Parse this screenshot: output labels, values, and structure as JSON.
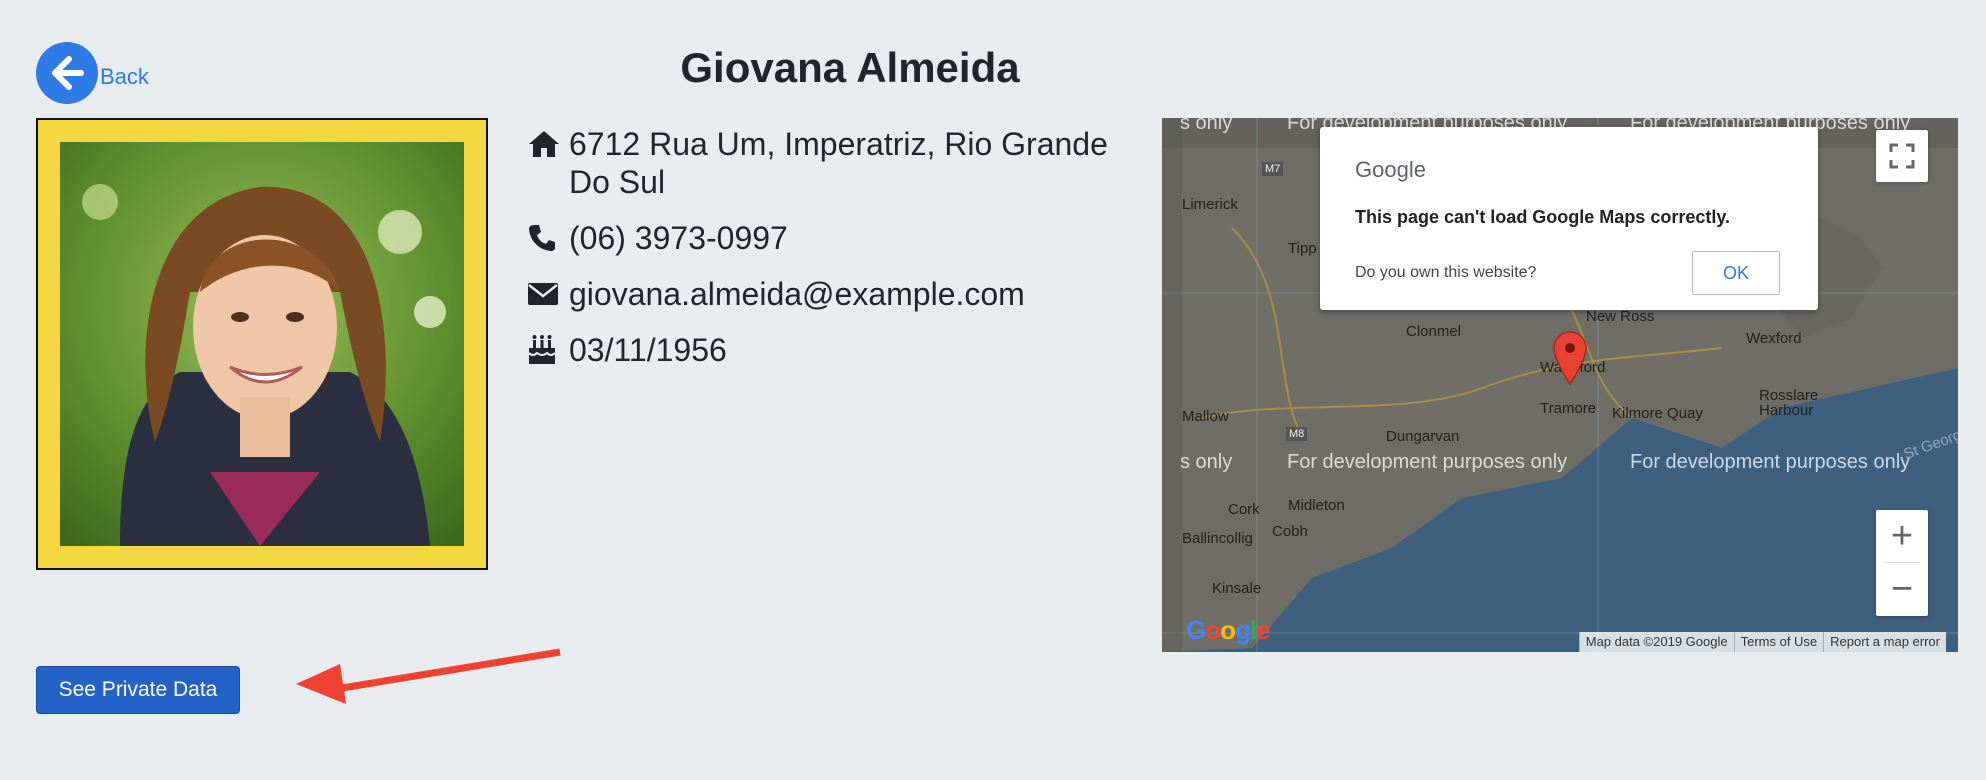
{
  "nav": {
    "back_label": "Back"
  },
  "profile": {
    "name": "Giovana Almeida",
    "address": "6712 Rua Um, Imperatriz, Rio Grande Do Sul",
    "phone": "(06) 3973-0997",
    "email": "giovana.almeida@example.com",
    "birthday": "03/11/1956"
  },
  "map": {
    "dialog": {
      "logo": "Google",
      "message": "This page can't load Google Maps correctly.",
      "question": "Do you own this website?",
      "ok_label": "OK"
    },
    "watermark": "For development purposes only",
    "watermark_partial": "s only",
    "places": [
      "Limerick",
      "Tipp",
      "Clonmel",
      "New Ross",
      "Wexford",
      "Waterford",
      "Tramore",
      "Kilmore Quay",
      "Rosslare Harbour",
      "Mallow",
      "Dungarvan",
      "Midleton",
      "Cork",
      "Ballincollig",
      "Cobh",
      "Kinsale",
      "St George's"
    ],
    "road_labels": [
      "M7",
      "M8"
    ],
    "attribution": [
      "Map data ©2019 Google",
      "Terms of Use",
      "Report a map error"
    ],
    "google_logo": "Google",
    "zoom_in": "+",
    "zoom_out": "−"
  },
  "actions": {
    "private_data_label": "See Private Data"
  },
  "colors": {
    "accent": "#2f7ae5",
    "button": "#2462c8",
    "frame": "#f5d742",
    "arrow": "#ef4131",
    "map_sea": "#3f5f7f"
  }
}
